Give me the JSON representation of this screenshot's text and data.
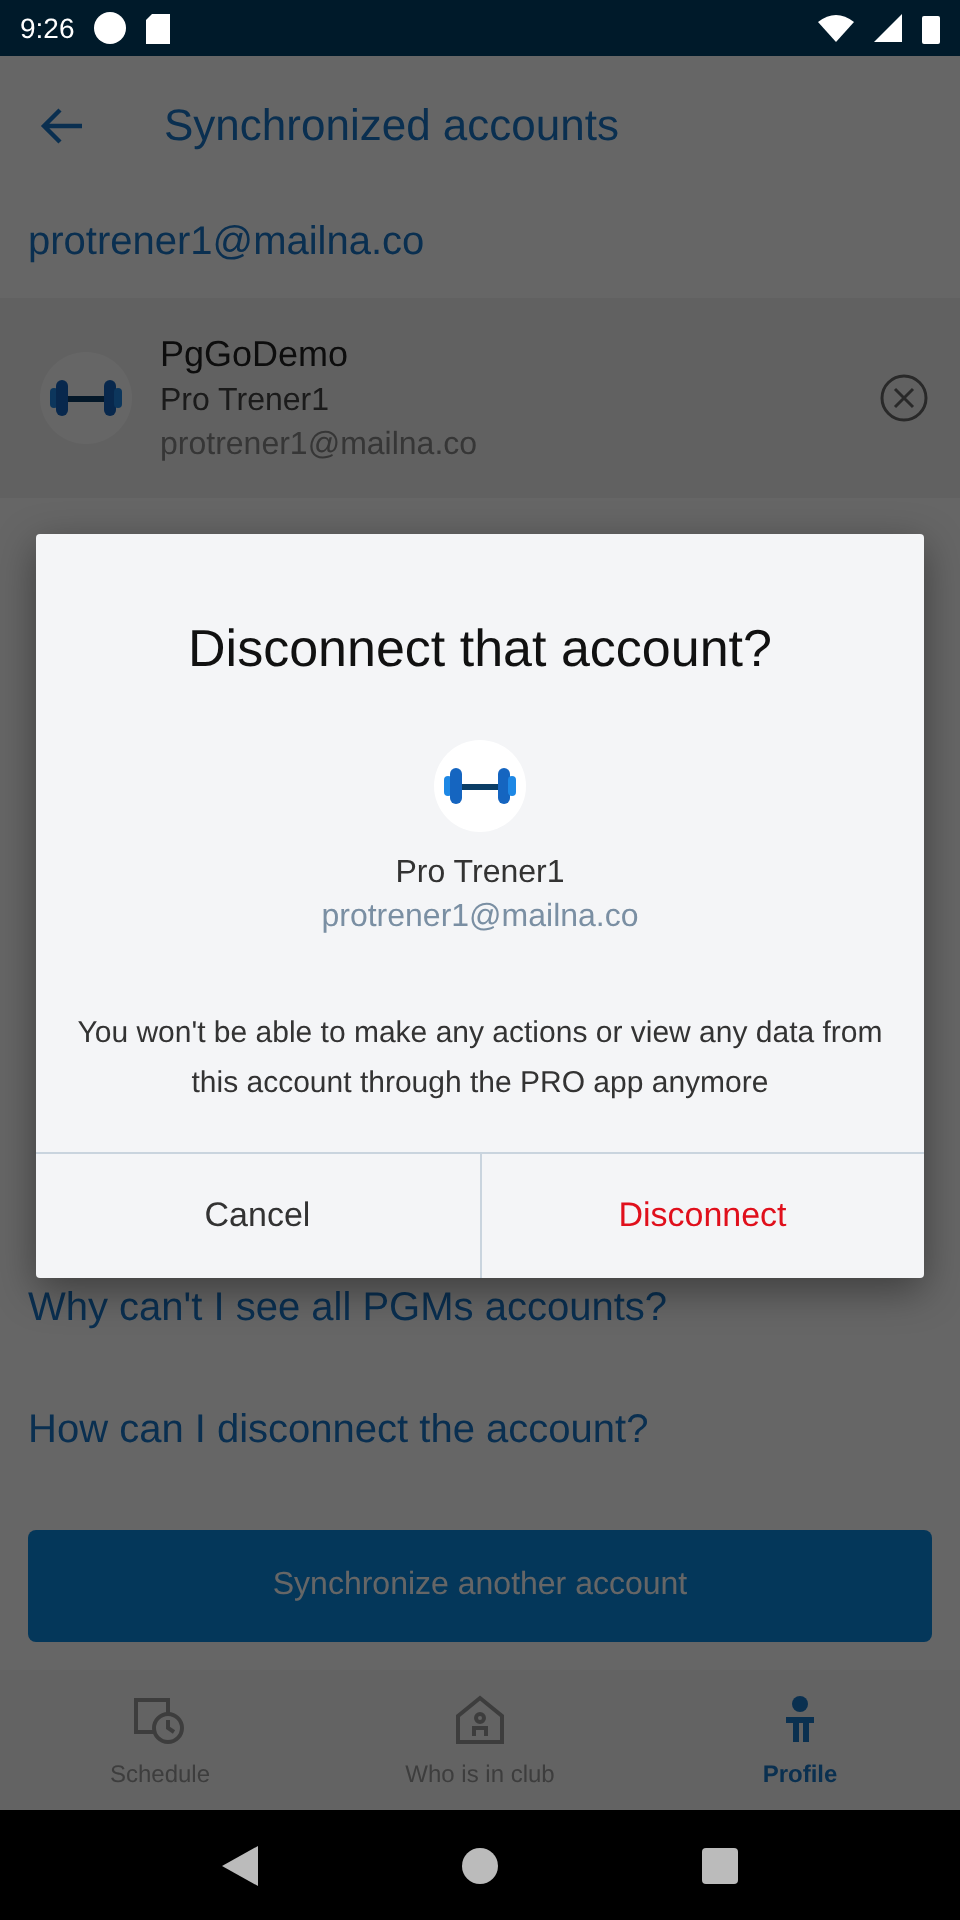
{
  "status_bar": {
    "time": "9:26"
  },
  "app_bar": {
    "title": "Synchronized accounts"
  },
  "account_group": {
    "heading": "protrener1@mailna.co",
    "account": {
      "club": "PgGoDemo",
      "name": "Pro Trener1",
      "email": "protrener1@mailna.co"
    }
  },
  "faq": [
    "Why can't I see all PGMs accounts?",
    "How can I disconnect the account?"
  ],
  "sync_button": "Synchronize another account",
  "nav": [
    {
      "label": "Schedule",
      "kind": "schedule",
      "selected": false
    },
    {
      "label": "Who is in club",
      "kind": "club",
      "selected": false
    },
    {
      "label": "Profile",
      "kind": "profile",
      "selected": true
    }
  ],
  "dialog": {
    "title": "Disconnect that account?",
    "name": "Pro Trener1",
    "email": "protrener1@mailna.co",
    "message": "You won't be able to make any actions or view any data from this account through the PRO app anymore",
    "buttons": [
      {
        "label": "Cancel",
        "kind": "neutral"
      },
      {
        "label": "Disconnect",
        "kind": "danger"
      }
    ]
  }
}
